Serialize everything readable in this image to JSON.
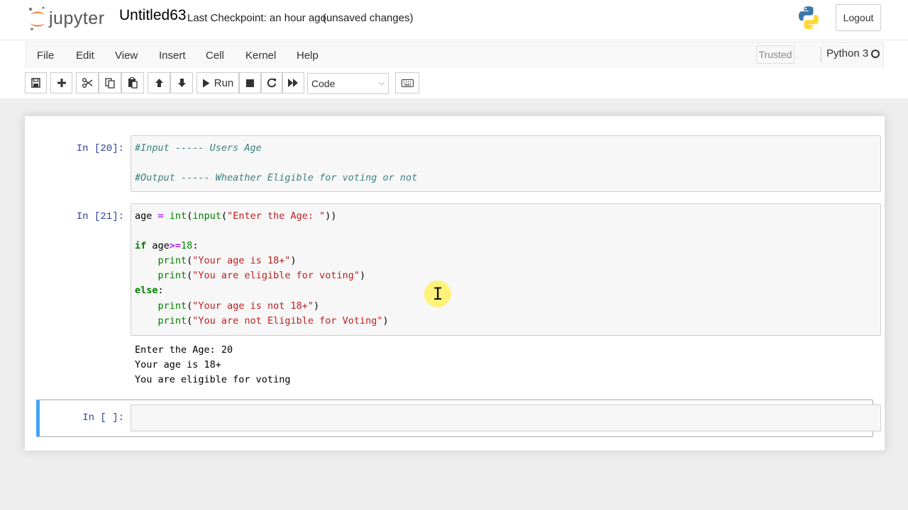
{
  "header": {
    "logo_text": "jupyter",
    "notebook_title": "Untitled63",
    "checkpoint": "Last Checkpoint: an hour ago",
    "unsaved": "(unsaved changes)",
    "logout_label": "Logout",
    "python_logo_icon": "python-logo-icon"
  },
  "menubar": {
    "items": [
      "File",
      "Edit",
      "View",
      "Insert",
      "Cell",
      "Kernel",
      "Help"
    ],
    "trusted_label": "Trusted",
    "kernel_name": "Python 3"
  },
  "toolbar": {
    "icons": [
      "save-icon",
      "plus-icon",
      "cut-icon",
      "copy-icon",
      "paste-icon",
      "arrow-up-icon",
      "arrow-down-icon",
      "run-icon",
      "stop-icon",
      "restart-icon",
      "fast-forward-icon",
      "keyboard-icon"
    ],
    "run_label": "Run",
    "cell_type": "Code"
  },
  "cells": [
    {
      "prompt": "In [20]:",
      "lines": [
        "#Input ----- Users Age",
        "",
        "#Output ----- Wheather Eligible for voting or not"
      ]
    },
    {
      "prompt": "In [21]:",
      "lines": [
        "age = int(input(\"Enter the Age: \"))",
        "",
        "if age>=18:",
        "    print(\"Your age is 18+\")",
        "    print(\"You are eligible for voting\")",
        "else:",
        "    print(\"Your age is not 18+\")",
        "    print(\"You are not Eligible for Voting\")"
      ],
      "output": [
        "Enter the Age: 20",
        "Your age is 18+",
        "You are eligible for voting"
      ]
    },
    {
      "prompt": "In [ ]:",
      "lines": [
        ""
      ]
    }
  ],
  "colors": {
    "prompt": "#303f9f",
    "selected_border": "#42a5f5",
    "comment": "#408080",
    "keyword": "#008000",
    "string": "#ba2121"
  }
}
